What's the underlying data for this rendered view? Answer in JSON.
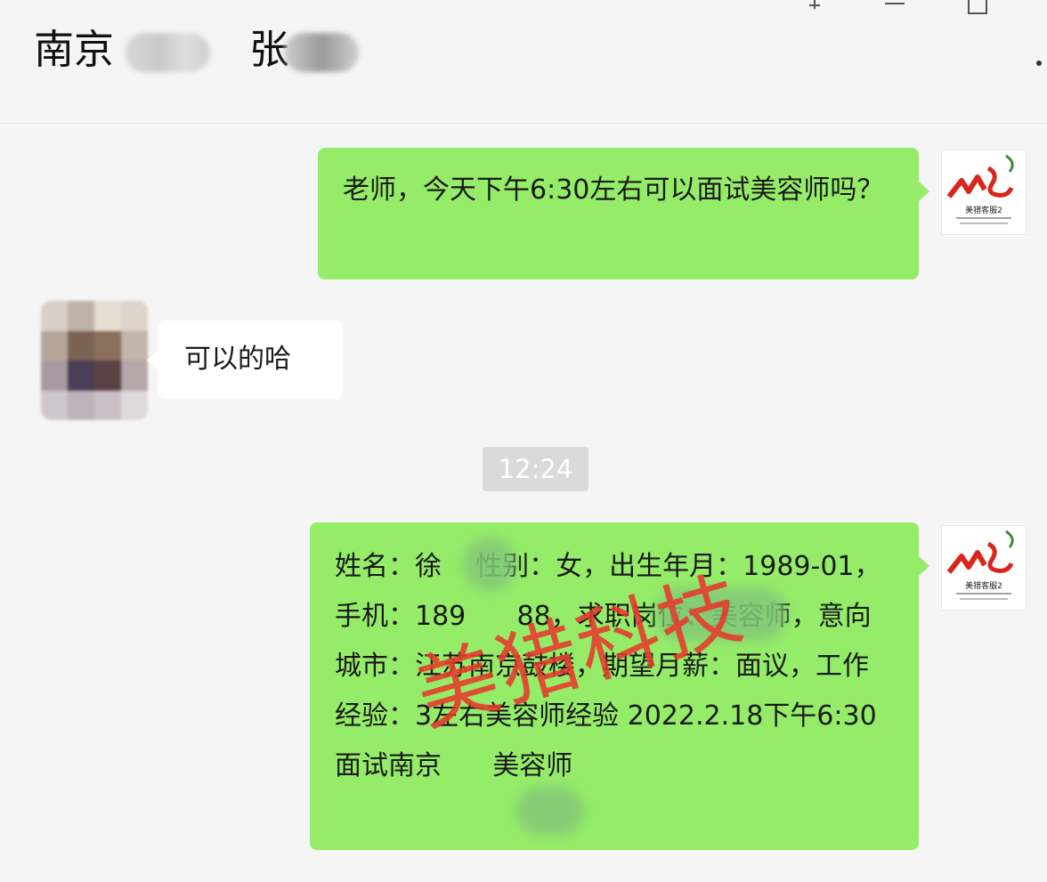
{
  "header": {
    "title_part1": "南京",
    "title_part2": "张"
  },
  "icons": {
    "pin": "pin-icon",
    "minimize": "minimize-icon",
    "maximize": "maximize-icon",
    "more": "more-dots-icon"
  },
  "messages": [
    {
      "side": "right",
      "text": "老师，今天下午6:30左右可以面试美容师吗？"
    },
    {
      "side": "left",
      "text": "可以的哈"
    },
    {
      "side": "right",
      "text": "姓名：徐    性别：女，出生年月：1989-01，手机：189      88，求职岗位：美容师，意向城市：江苏南京鼓楼，期望月薪：面议，工作经验：3左右美容师经验 2022.2.18下午6:30面试南京      美容师"
    }
  ],
  "timestamp": "12:24",
  "watermark": "美猎科技",
  "avatar_logo_text": "美猎客服2",
  "colors": {
    "bubble_self": "#95ec69",
    "bubble_other": "#ffffff",
    "background": "#f5f5f5",
    "watermark": "#e8392c",
    "logo_red": "#d9261c"
  }
}
